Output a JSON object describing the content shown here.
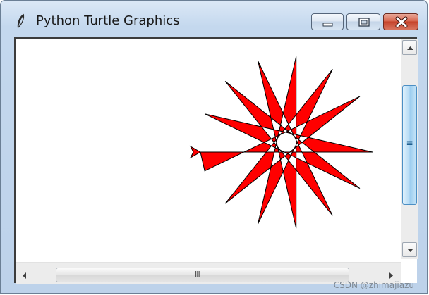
{
  "window": {
    "title": "Python Turtle Graphics",
    "app_icon": "feather-icon"
  },
  "caption_buttons": {
    "minimize_icon": "minimize-icon",
    "maximize_icon": "maximize-icon",
    "close_icon": "close-icon"
  },
  "canvas": {
    "shape": "star",
    "star_points": 14,
    "fill_color": "#ff0000",
    "outline_color": "#000000",
    "turtle_icon": "turtle-arrow-icon"
  },
  "scrollbars": {
    "vertical_thumb_grip": "≡",
    "horizontal_thumb_grip": "III"
  },
  "watermark": "CSDN @zhimajiazu",
  "colors": {
    "titlebar": "#c4d8ee",
    "close_button": "#c5442c",
    "canvas_background": "#ffffff"
  }
}
